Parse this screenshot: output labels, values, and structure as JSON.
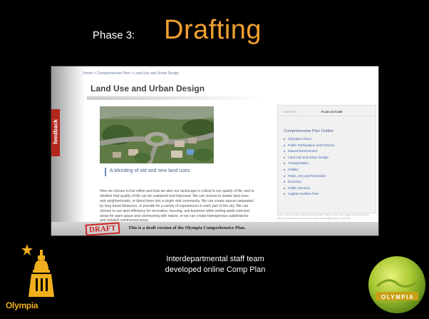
{
  "slide": {
    "phase_label": "Phase 3:",
    "phase_title": "Drafting",
    "caption_lines": [
      "Interdepartmental staff team",
      "developed online Comp Plan"
    ]
  },
  "web_page": {
    "breadcrumb": "Home > Comprehensive Plan > Land Use and Urban Design",
    "title": "Land Use and Urban Design",
    "feedback_tab": "feedback",
    "image_caption": "A blending of old and new land uses.",
    "body_text": "How we choose to live within and how we alter our landscape is critical to our quality of life, and to whether that quality of life can be sustained and improved. We can choose to isolate land uses and neighborhoods, or blend them into a single vital community. We can create spaces separated by long travel distances, or provide for a variety of experiences in each part of the city. We can choose to use land efficiency for recreation, housing, and business while setting aside selected areas for open space and communing with nature, or we can create homogenous subdivisions and isolated commercial areas.",
    "sidebar": {
      "tab_chapter": "CHAPTER",
      "tab_outline": "PLAN OUTLINE",
      "outline_title": "Comprehensive Plan Outline",
      "items": [
        "Olympia's Vision",
        "Public Participation and Partners",
        "Natural Environment",
        "Land Use and Urban Design",
        "Transportation",
        "Utilities",
        "Parks, Arts and Recreation",
        "Economy",
        "Public Services",
        "Capital Facilities Plan"
      ],
      "note": "Note: Links from this draft Comprehensive Plan to other web pages and documents are for convenience and do not make those pages part of this Plan."
    },
    "draft_stamp": "DRAFT",
    "draft_notice": "This is a draft version of the Olympia Comprehensive Plan."
  },
  "logos": {
    "left_text": "Olympia",
    "right_text": "OLYMPIA"
  },
  "colors": {
    "accent_orange": "#f0a030",
    "feedback_red": "#b3261e",
    "link_blue": "#3d64a8"
  }
}
